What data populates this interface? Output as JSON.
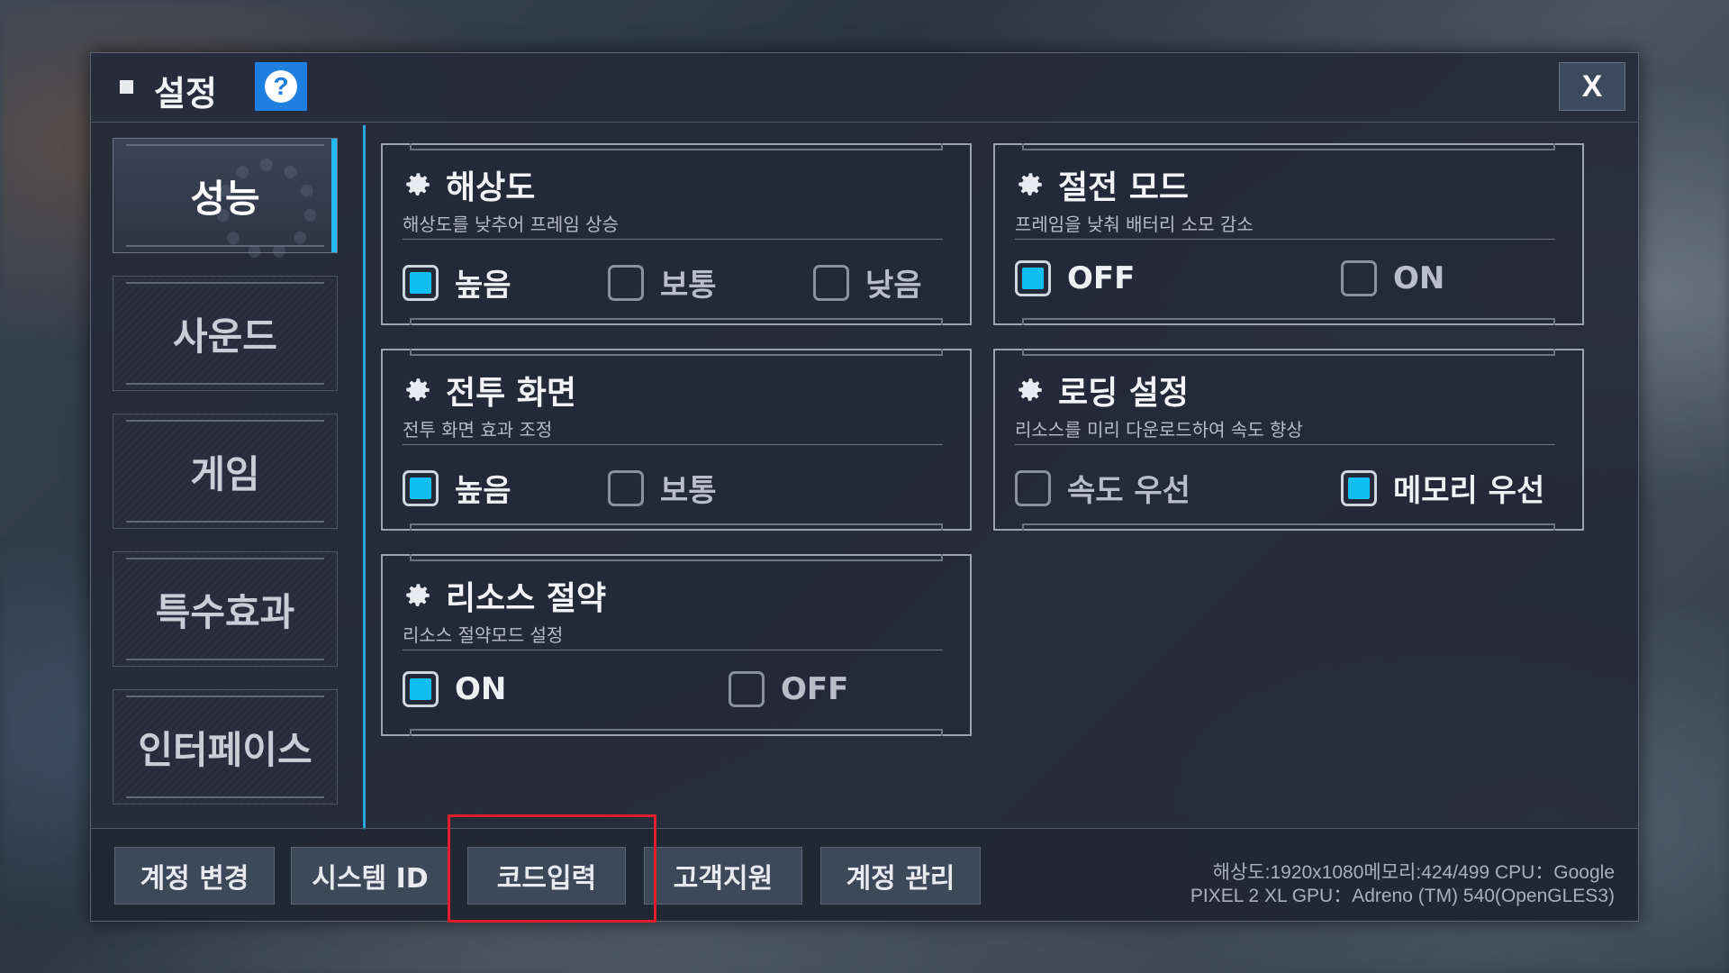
{
  "dialog": {
    "title": "설정",
    "help_icon": "?",
    "close_icon": "X"
  },
  "sidebar": {
    "items": [
      {
        "label": "성능",
        "active": true
      },
      {
        "label": "사운드",
        "active": false
      },
      {
        "label": "게임",
        "active": false
      },
      {
        "label": "특수효과",
        "active": false
      },
      {
        "label": "인터페이스",
        "active": false
      }
    ]
  },
  "panels": {
    "resolution": {
      "title": "해상도",
      "desc": "해상도를 낮추어 프레임 상승",
      "options": [
        {
          "label": "높음",
          "checked": true
        },
        {
          "label": "보통",
          "checked": false
        },
        {
          "label": "낮음",
          "checked": false
        }
      ]
    },
    "power_saving": {
      "title": "절전 모드",
      "desc": "프레임을 낮춰 배터리 소모 감소",
      "options": [
        {
          "label": "OFF",
          "checked": true
        },
        {
          "label": "ON",
          "checked": false
        }
      ]
    },
    "battle_screen": {
      "title": "전투 화면",
      "desc": "전투 화면 효과 조정",
      "options": [
        {
          "label": "높음",
          "checked": true
        },
        {
          "label": "보통",
          "checked": false
        }
      ]
    },
    "loading": {
      "title": "로딩 설정",
      "desc": "리소스를 미리 다운로드하여 속도 향상",
      "options": [
        {
          "label": "속도 우선",
          "checked": false
        },
        {
          "label": "메모리 우선",
          "checked": true
        }
      ]
    },
    "resource_saving": {
      "title": "리소스 절약",
      "desc": "리소스 절약모드 설정",
      "options": [
        {
          "label": "ON",
          "checked": true
        },
        {
          "label": "OFF",
          "checked": false
        }
      ]
    }
  },
  "bottom": {
    "buttons": [
      "계정 변경",
      "시스템 ID",
      "코드입력",
      "고객지원",
      "계정 관리"
    ],
    "sysinfo_line1": "해상도:1920x1080메모리:424/499 CPU：Google",
    "sysinfo_line2": "PIXEL 2 XL  GPU：Adreno (TM) 540(OpenGLES3)"
  },
  "colors": {
    "accent": "#12bff5",
    "divider": "#27a7db",
    "help": "#1e7fe0",
    "highlight": "#e3202a"
  }
}
